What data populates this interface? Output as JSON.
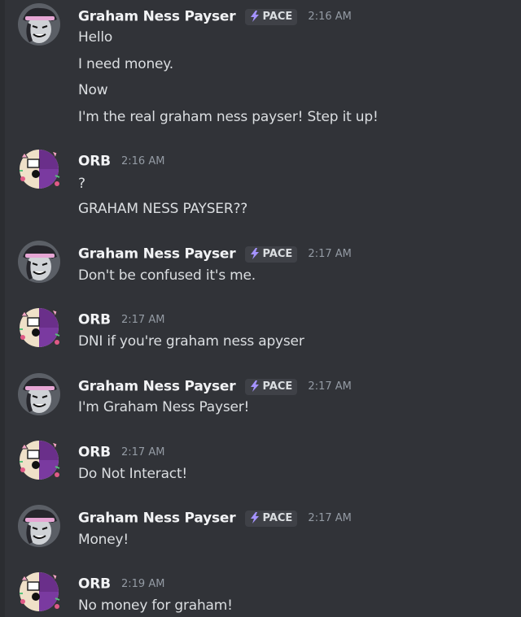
{
  "colors": {
    "background": "#313338",
    "username": "#f2f3f5",
    "message_text": "#dbdee1",
    "timestamp": "#949ba4",
    "tag_background": "#3f4147",
    "tag_icon": "#a593ff"
  },
  "messages": [
    {
      "author": "Graham Ness Payser",
      "tag": "PACE",
      "time": "2:16 AM",
      "lines": [
        "Hello",
        "I need money.",
        "Now",
        "I'm the real graham ness payser! Step it up!"
      ]
    },
    {
      "author": "ORB",
      "time": "2:16 AM",
      "lines": [
        "?",
        "GRAHAM NESS PAYSER??"
      ]
    },
    {
      "author": "Graham Ness Payser",
      "tag": "PACE",
      "time": "2:17 AM",
      "lines": [
        "Don't be confused it's me."
      ]
    },
    {
      "author": "ORB",
      "time": "2:17 AM",
      "lines": [
        "DNI if you're graham ness apyser"
      ]
    },
    {
      "author": "Graham Ness Payser",
      "tag": "PACE",
      "time": "2:17 AM",
      "lines": [
        "I'm Graham Ness Payser!"
      ]
    },
    {
      "author": "ORB",
      "time": "2:17 AM",
      "lines": [
        "Do Not Interact!"
      ]
    },
    {
      "author": "Graham Ness Payser",
      "tag": "PACE",
      "time": "2:17 AM",
      "lines": [
        "Money!"
      ]
    },
    {
      "author": "ORB",
      "time": "2:19 AM",
      "lines": [
        "No money for graham!"
      ]
    }
  ]
}
